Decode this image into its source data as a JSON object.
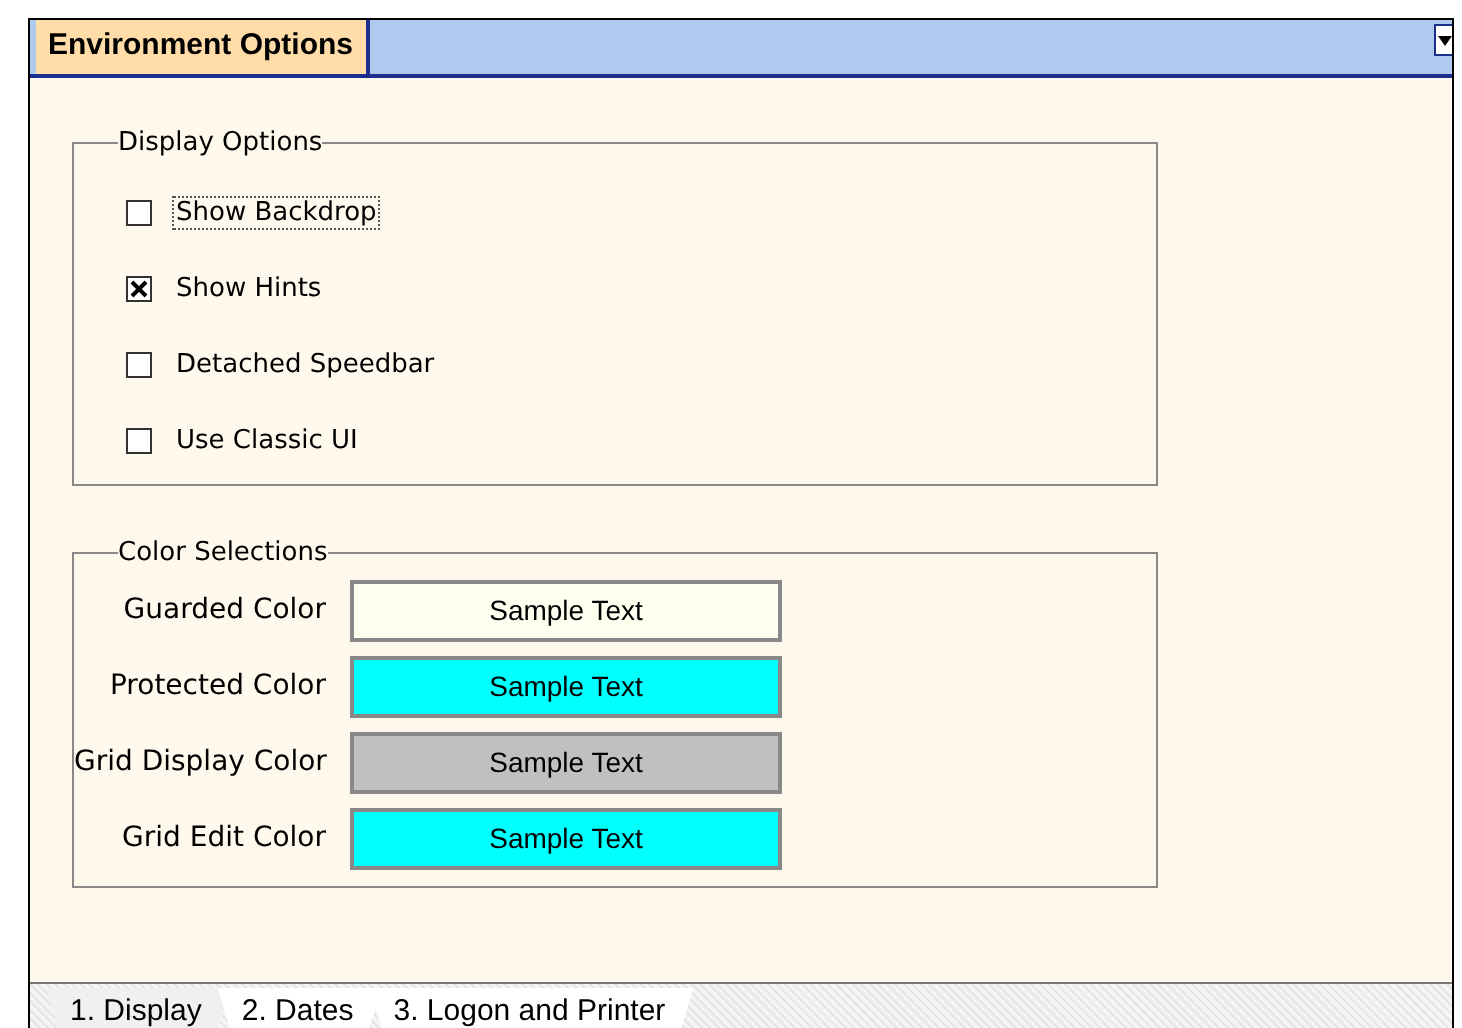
{
  "window": {
    "title": "Environment Options"
  },
  "display_options": {
    "title": "Display Options",
    "items": [
      {
        "label": "Show Backdrop",
        "checked": false,
        "focused": true
      },
      {
        "label": "Show Hints",
        "checked": true,
        "focused": false
      },
      {
        "label": "Detached Speedbar",
        "checked": false,
        "focused": false
      },
      {
        "label": "Use Classic UI",
        "checked": false,
        "focused": false
      }
    ]
  },
  "color_selections": {
    "title": "Color Selections",
    "items": [
      {
        "label": "Guarded Color",
        "sample": "Sample Text",
        "color": "#fffff0"
      },
      {
        "label": "Protected Color",
        "sample": "Sample Text",
        "color": "#00ffff"
      },
      {
        "label": "Grid Display Color",
        "sample": "Sample Text",
        "color": "#c0c0c0"
      },
      {
        "label": "Grid Edit Color",
        "sample": "Sample Text",
        "color": "#00ffff"
      }
    ]
  },
  "tabs": [
    {
      "label": "1. Display",
      "selected": true
    },
    {
      "label": "2. Dates",
      "selected": false
    },
    {
      "label": "3. Logon and Printer",
      "selected": false
    }
  ]
}
